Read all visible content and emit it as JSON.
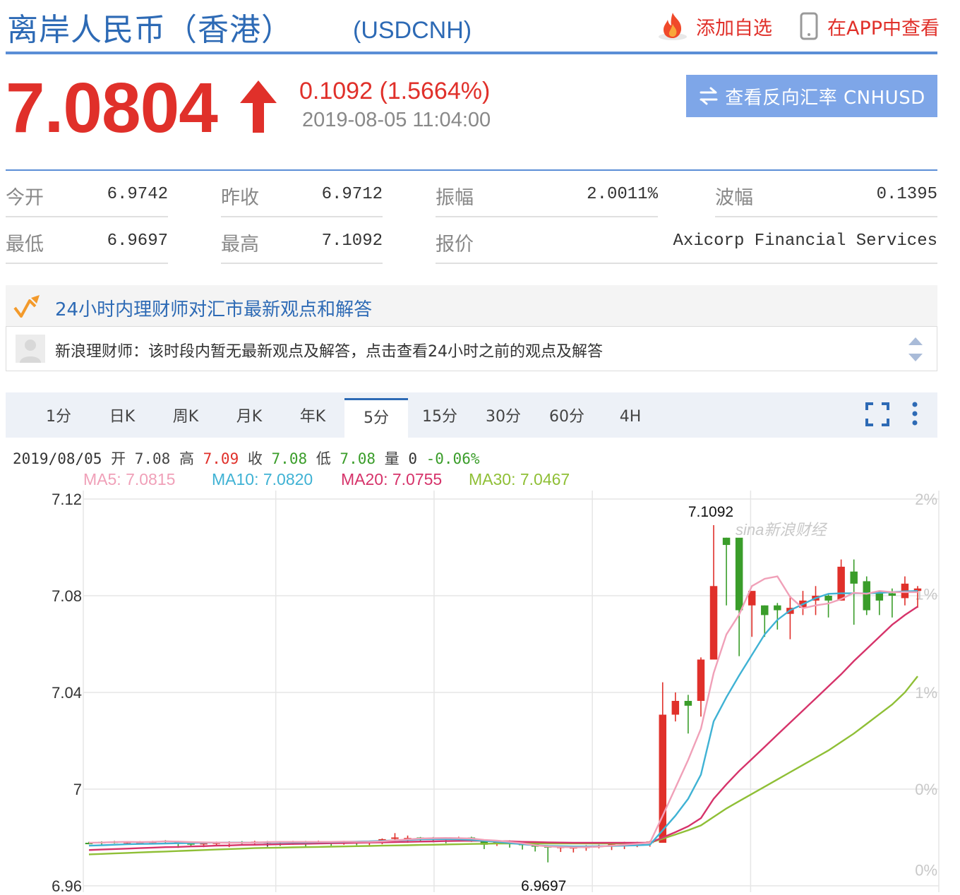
{
  "header": {
    "title": "离岸人民币（香港）",
    "symbol": "(USDCNH)",
    "add_watchlist": "添加自选",
    "view_in_app": "在APP中查看"
  },
  "quote": {
    "price": "7.0804",
    "change": "0.1092 (1.5664%)",
    "timestamp": "2019-08-05 11:04:00",
    "reverse_button": "查看反向汇率 CNHUSD",
    "up_color": "#e0302a"
  },
  "stats": {
    "open_label": "今开",
    "open": "6.9742",
    "prev_close_label": "昨收",
    "prev_close": "6.9712",
    "amplitude_label": "振幅",
    "amplitude": "2.0011%",
    "range_label": "波幅",
    "range": "0.1395",
    "low_label": "最低",
    "low": "6.9697",
    "high_label": "最高",
    "high": "7.1092",
    "quote_source_label": "报价",
    "quote_source": "Axicorp Financial Services"
  },
  "advisor": {
    "title": "24小时内理财师对汇市最新观点和解答",
    "message": "新浪理财师：该时段内暂无最新观点及解答，点击查看24小时之前的观点及解答"
  },
  "tabs": [
    {
      "label": "1分"
    },
    {
      "label": "日K"
    },
    {
      "label": "周K"
    },
    {
      "label": "月K"
    },
    {
      "label": "年K"
    },
    {
      "label": "5分"
    },
    {
      "label": "15分"
    },
    {
      "label": "30分"
    },
    {
      "label": "60分"
    },
    {
      "label": "4H"
    }
  ],
  "active_tab": "5分",
  "ohlc_bar": {
    "date": "2019/08/05",
    "open_label": "开",
    "open": "7.08",
    "high_label": "高",
    "high": "7.09",
    "close_label": "收",
    "close": "7.08",
    "low_label": "低",
    "low": "7.08",
    "volume_label": "量",
    "volume": "0",
    "change": "-0.06%"
  },
  "ma_labels": [
    {
      "text": "MA5: 7.0815",
      "color": "#f0a0b8"
    },
    {
      "text": "MA10: 7.0820",
      "color": "#3fb2d4"
    },
    {
      "text": "MA20: 7.0755",
      "color": "#d6336a"
    },
    {
      "text": "MA30: 7.0467",
      "color": "#8fbf36"
    }
  ],
  "chart_data": {
    "type": "candlestick",
    "watermark": "sina新浪财经",
    "y_ticks": [
      "7.12",
      "7.08",
      "7.04",
      "7",
      "6.96"
    ],
    "y_tick_values": [
      7.12,
      7.08,
      7.04,
      7.0,
      6.96
    ],
    "pct_ticks": [
      "2%",
      "1%",
      "1%",
      "0%",
      "0%"
    ],
    "pct_tick_values": [
      7.12,
      7.0808,
      7.04,
      7.0,
      6.9665
    ],
    "ylim": [
      6.96,
      7.12
    ],
    "annotations": [
      {
        "text": "7.1092",
        "value": 7.1092,
        "candle": 48
      },
      {
        "text": "6.9697",
        "value": 6.9697,
        "candle": 36
      }
    ],
    "colors": {
      "up": "#e0302a",
      "down": "#3a9d2a",
      "flat": "#222222",
      "grid": "#e6e6e6"
    },
    "candles": [
      [
        6.9778,
        6.9776,
        6.9782,
        6.9772
      ],
      [
        6.9782,
        6.978,
        6.9784,
        6.977
      ],
      [
        6.9783,
        6.9782,
        6.9786,
        6.9775
      ],
      [
        6.978,
        6.9782,
        6.9784,
        6.9772
      ],
      [
        6.978,
        6.9782,
        6.9785,
        6.9772
      ],
      [
        6.9782,
        6.9783,
        6.9786,
        6.9775
      ],
      [
        6.9787,
        6.9785,
        6.9789,
        6.9778
      ],
      [
        6.9784,
        6.9779,
        6.9786,
        6.9757
      ],
      [
        6.9776,
        6.9774,
        6.9784,
        6.9762
      ],
      [
        6.9775,
        6.9777,
        6.9782,
        6.976
      ],
      [
        6.9777,
        6.9779,
        6.9783,
        6.9768
      ],
      [
        6.9779,
        6.9781,
        6.9784,
        6.976
      ],
      [
        6.9782,
        6.978,
        6.9785,
        6.977
      ],
      [
        6.9781,
        6.9783,
        6.9786,
        6.9768
      ],
      [
        6.9782,
        6.9782,
        6.9785,
        6.9762
      ],
      [
        6.9783,
        6.9781,
        6.9785,
        6.9765
      ],
      [
        6.9781,
        6.9783,
        6.9786,
        6.977
      ],
      [
        6.9784,
        6.9782,
        6.9786,
        6.9762
      ],
      [
        6.9782,
        6.9784,
        6.9787,
        6.9775
      ],
      [
        6.9782,
        6.978,
        6.9784,
        6.9766
      ],
      [
        6.978,
        6.9782,
        6.9786,
        6.977
      ],
      [
        6.9782,
        6.978,
        6.9785,
        6.9768
      ],
      [
        6.9782,
        6.9784,
        6.9787,
        6.9762
      ],
      [
        6.9788,
        6.9793,
        6.9796,
        6.9772
      ],
      [
        6.9795,
        6.98,
        6.9818,
        6.9782
      ],
      [
        6.979,
        6.9798,
        6.9808,
        6.9778
      ],
      [
        6.98,
        6.9795,
        6.9802,
        6.9782
      ],
      [
        6.9798,
        6.9794,
        6.9802,
        6.978
      ],
      [
        6.9796,
        6.9794,
        6.98,
        6.9776
      ],
      [
        6.9796,
        6.98,
        6.9803,
        6.9785
      ],
      [
        6.98,
        6.9796,
        6.9803,
        6.9782
      ],
      [
        6.9786,
        6.977,
        6.979,
        6.9752
      ],
      [
        6.9778,
        6.978,
        6.9782,
        6.9765
      ],
      [
        6.9782,
        6.9778,
        6.9788,
        6.9758
      ],
      [
        6.9774,
        6.9768,
        6.9776,
        6.975
      ],
      [
        6.9772,
        6.9762,
        6.9778,
        6.9742
      ],
      [
        6.9764,
        6.976,
        6.9768,
        6.9697
      ],
      [
        6.9757,
        6.9762,
        6.9765,
        6.974
      ],
      [
        6.9758,
        6.976,
        6.9762,
        6.9738
      ],
      [
        6.976,
        6.9762,
        6.9768,
        6.9745
      ],
      [
        6.9764,
        6.9766,
        6.977,
        6.9755
      ],
      [
        6.977,
        6.9772,
        6.9775,
        6.9748
      ],
      [
        6.9772,
        6.9778,
        6.9782,
        6.9752
      ],
      [
        6.9775,
        6.9778,
        6.9782,
        6.976
      ],
      [
        6.978,
        6.9783,
        6.9786,
        6.9762
      ],
      [
        6.9778,
        7.0308,
        7.0442,
        6.9782
      ],
      [
        7.0308,
        7.0365,
        7.04,
        7.028
      ],
      [
        7.0365,
        7.0345,
        7.039,
        7.023
      ],
      [
        7.0365,
        7.0536,
        7.0545,
        7.03
      ],
      [
        7.0536,
        7.084,
        7.1092,
        7.08
      ],
      [
        7.104,
        7.101,
        7.104,
        7.076
      ],
      [
        7.104,
        7.074,
        7.086,
        7.055
      ],
      [
        7.076,
        7.082,
        7.08,
        7.063
      ],
      [
        7.076,
        7.072,
        7.076,
        7.063
      ],
      [
        7.076,
        7.074,
        7.077,
        7.066
      ],
      [
        7.0725,
        7.075,
        7.08,
        7.062
      ],
      [
        7.075,
        7.078,
        7.082,
        7.072
      ],
      [
        7.078,
        7.08,
        7.084,
        7.072
      ],
      [
        7.08,
        7.078,
        7.081,
        7.071
      ],
      [
        7.078,
        7.092,
        7.095,
        7.078
      ],
      [
        7.09,
        7.085,
        7.095,
        7.068
      ],
      [
        7.086,
        7.074,
        7.088,
        7.072
      ],
      [
        7.082,
        7.078,
        7.079,
        7.072
      ],
      [
        7.081,
        7.08,
        7.083,
        7.071
      ],
      [
        7.079,
        7.085,
        7.088,
        7.076
      ],
      [
        7.082,
        7.083,
        7.084,
        7.075
      ]
    ],
    "ma5": [
      6.9778,
      6.9779,
      6.9781,
      6.9782,
      6.9781,
      6.9782,
      6.9784,
      6.9783,
      6.9781,
      6.978,
      6.9779,
      6.9778,
      6.9778,
      6.9779,
      6.9781,
      6.9782,
      6.9782,
      6.9782,
      6.9782,
      6.9782,
      6.9783,
      6.9782,
      6.9782,
      6.9784,
      6.9788,
      6.9792,
      6.9796,
      6.9797,
      6.9798,
      6.9797,
      6.9796,
      6.979,
      6.9787,
      6.9782,
      6.9776,
      6.9768,
      6.9763,
      6.9761,
      6.9759,
      6.976,
      6.9762,
      6.9766,
      6.977,
      6.9774,
      6.9778,
      6.989,
      7.0005,
      7.0121,
      7.025,
      7.048,
      7.064,
      7.0722,
      7.084,
      7.087,
      7.088,
      7.0795,
      7.0748,
      7.076,
      7.0768,
      7.0786,
      7.0812,
      7.0808,
      7.082,
      7.0815,
      7.0815,
      7.0815
    ],
    "ma10": [
      6.9766,
      6.9768,
      6.977,
      6.9772,
      6.9773,
      6.9774,
      6.9775,
      6.9776,
      6.9777,
      6.9778,
      6.9779,
      6.9779,
      6.9779,
      6.9779,
      6.978,
      6.978,
      6.978,
      6.978,
      6.9781,
      6.9781,
      6.9782,
      6.9783,
      6.9784,
      6.9786,
      6.9788,
      6.979,
      6.9792,
      6.9793,
      6.9793,
      6.9792,
      6.979,
      6.9786,
      6.9782,
      6.9777,
      6.9772,
      6.9768,
      6.9765,
      6.9764,
      6.9763,
      6.9763,
      6.9764,
      6.9765,
      6.9766,
      6.9768,
      6.977,
      6.983,
      6.989,
      6.996,
      7.006,
      7.028,
      7.038,
      7.047,
      7.0555,
      7.064,
      7.07,
      7.074,
      7.0765,
      7.079,
      7.0808,
      7.081,
      7.081,
      7.081,
      7.0812,
      7.0815,
      7.0818,
      7.082
    ],
    "ma20": [
      6.9748,
      6.975,
      6.9752,
      6.9754,
      6.9756,
      6.9758,
      6.976,
      6.9761,
      6.9763,
      6.9764,
      6.9766,
      6.9767,
      6.9769,
      6.977,
      6.9771,
      6.9772,
      6.9773,
      6.9774,
      6.9775,
      6.9776,
      6.9777,
      6.9778,
      6.9779,
      6.978,
      6.9781,
      6.9782,
      6.9783,
      6.9784,
      6.9785,
      6.9786,
      6.9787,
      6.9786,
      6.9785,
      6.9784,
      6.9782,
      6.9781,
      6.978,
      6.9779,
      6.9778,
      6.9778,
      6.9778,
      6.9778,
      6.9778,
      6.9778,
      6.9778,
      6.98,
      6.9822,
      6.9846,
      6.988,
      6.996,
      7.002,
      7.0075,
      7.0125,
      7.0175,
      7.0225,
      7.0275,
      7.0325,
      7.0375,
      7.0425,
      7.0475,
      7.053,
      7.058,
      7.063,
      7.068,
      7.072,
      7.0755
    ],
    "ma30": [
      6.973,
      6.9732,
      6.9734,
      6.9736,
      6.9738,
      6.974,
      6.9742,
      6.9744,
      6.9746,
      6.9748,
      6.975,
      6.9752,
      6.9754,
      6.9756,
      6.9757,
      6.9758,
      6.9759,
      6.976,
      6.9761,
      6.9762,
      6.9763,
      6.9764,
      6.9765,
      6.9766,
      6.9767,
      6.9768,
      6.9769,
      6.977,
      6.9771,
      6.9772,
      6.9773,
      6.9774,
      6.9775,
      6.9775,
      6.9775,
      6.9775,
      6.9775,
      6.9775,
      6.9775,
      6.9775,
      6.9775,
      6.9775,
      6.9776,
      6.9777,
      6.9778,
      6.9795,
      6.9812,
      6.983,
      6.985,
      6.9885,
      6.992,
      6.995,
      6.998,
      7.001,
      7.004,
      7.007,
      7.01,
      7.013,
      7.016,
      7.0195,
      7.023,
      7.027,
      7.031,
      7.035,
      7.04,
      7.0467
    ]
  }
}
